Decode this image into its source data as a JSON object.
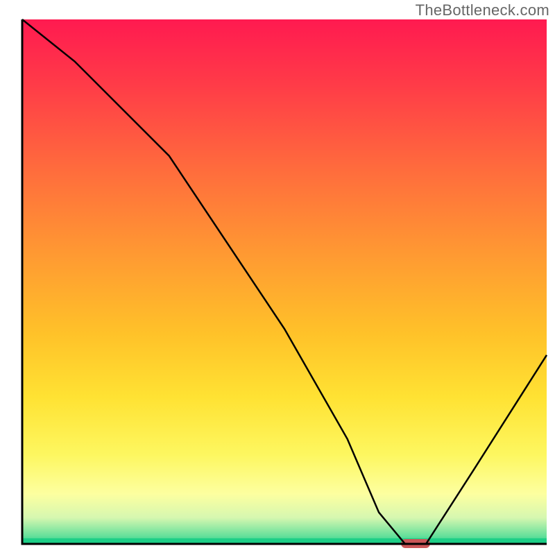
{
  "watermark": "TheBottleneck.com",
  "chart_data": {
    "type": "line",
    "title": "",
    "xlabel": "",
    "ylabel": "",
    "xlim": [
      0,
      100
    ],
    "ylim": [
      0,
      100
    ],
    "grid": false,
    "legend": false,
    "background_gradient": {
      "type": "vertical",
      "stops": [
        {
          "pos": 0.0,
          "color": "#ff1a50"
        },
        {
          "pos": 0.12,
          "color": "#ff3a48"
        },
        {
          "pos": 0.28,
          "color": "#ff6a3d"
        },
        {
          "pos": 0.45,
          "color": "#ff9a32"
        },
        {
          "pos": 0.6,
          "color": "#ffc229"
        },
        {
          "pos": 0.72,
          "color": "#ffe233"
        },
        {
          "pos": 0.83,
          "color": "#fdf760"
        },
        {
          "pos": 0.905,
          "color": "#fdffa0"
        },
        {
          "pos": 0.95,
          "color": "#d6f7b0"
        },
        {
          "pos": 0.985,
          "color": "#65e09b"
        },
        {
          "pos": 1.0,
          "color": "#1dcf87"
        }
      ]
    },
    "series": [
      {
        "name": "curve",
        "x": [
          0,
          10,
          28,
          50,
          62,
          68,
          73,
          77,
          86,
          100
        ],
        "y": [
          100,
          92,
          74,
          41,
          20,
          6,
          0,
          0,
          14,
          36
        ]
      }
    ],
    "marker": {
      "name": "highlight",
      "x_center": 75,
      "y": 0,
      "width_pct": 5.5,
      "color": "#cb5658",
      "shape": "capsule"
    }
  }
}
